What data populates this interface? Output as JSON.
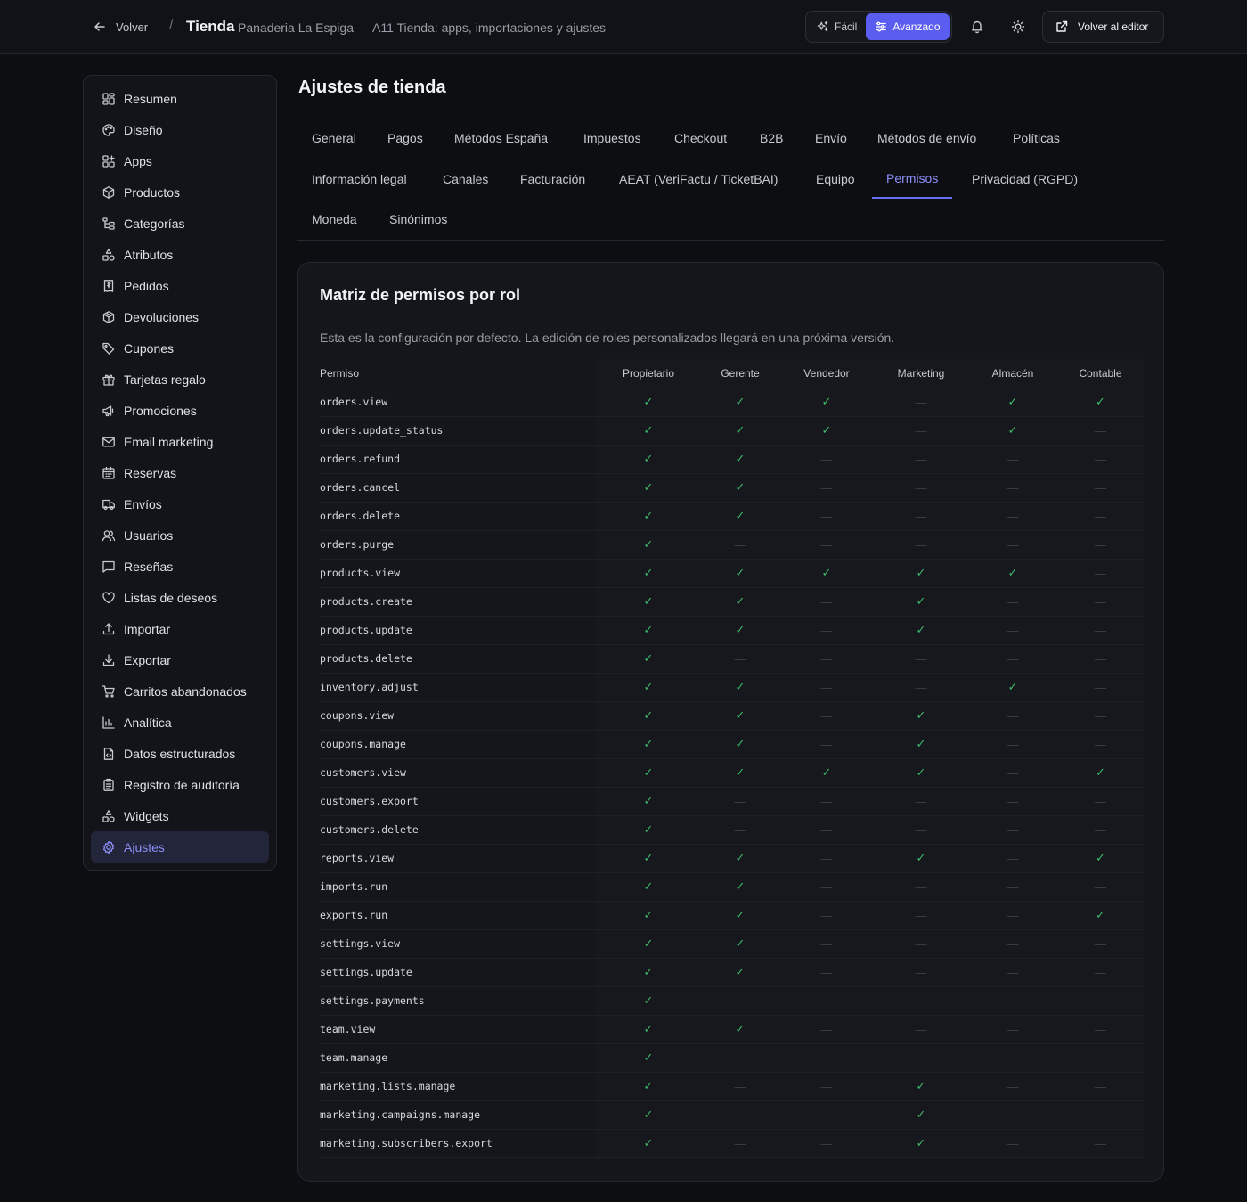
{
  "header": {
    "back_label": "Volver",
    "separator": "/",
    "title": "Tienda",
    "subtitle": "Panaderia La Espiga — A11 Tienda: apps, importaciones y ajustes",
    "mode_easy": "Fácil",
    "mode_advanced": "Avanzado",
    "active_mode": "Avanzado",
    "editor_button": "Volver al editor"
  },
  "colors": {
    "accent": "#5b5cf0",
    "active_link": "#8d8ff8",
    "check": "#3fb96a",
    "background": "#0d0e12"
  },
  "sidebar": {
    "active": "Ajustes",
    "items": [
      {
        "label": "Resumen",
        "icon": "dashboard-icon"
      },
      {
        "label": "Diseño",
        "icon": "palette-icon"
      },
      {
        "label": "Apps",
        "icon": "apps-icon"
      },
      {
        "label": "Productos",
        "icon": "box-icon"
      },
      {
        "label": "Categorías",
        "icon": "category-tree-icon"
      },
      {
        "label": "Atributos",
        "icon": "shapes-icon"
      },
      {
        "label": "Pedidos",
        "icon": "receipt-icon"
      },
      {
        "label": "Devoluciones",
        "icon": "package-return-icon"
      },
      {
        "label": "Cupones",
        "icon": "tag-icon"
      },
      {
        "label": "Tarjetas regalo",
        "icon": "gift-icon"
      },
      {
        "label": "Promociones",
        "icon": "megaphone-icon"
      },
      {
        "label": "Email marketing",
        "icon": "mail-icon"
      },
      {
        "label": "Reservas",
        "icon": "calendar-icon"
      },
      {
        "label": "Envíos",
        "icon": "truck-icon"
      },
      {
        "label": "Usuarios",
        "icon": "users-icon"
      },
      {
        "label": "Reseñas",
        "icon": "message-icon"
      },
      {
        "label": "Listas de deseos",
        "icon": "heart-icon"
      },
      {
        "label": "Importar",
        "icon": "upload-icon"
      },
      {
        "label": "Exportar",
        "icon": "download-icon"
      },
      {
        "label": "Carritos abandonados",
        "icon": "cart-icon"
      },
      {
        "label": "Analítica",
        "icon": "bar-chart-icon"
      },
      {
        "label": "Datos estructurados",
        "icon": "file-code-icon"
      },
      {
        "label": "Registro de auditoría",
        "icon": "clipboard-icon"
      },
      {
        "label": "Widgets",
        "icon": "widgets-icon"
      },
      {
        "label": "Ajustes",
        "icon": "gear-icon"
      }
    ]
  },
  "page": {
    "title": "Ajustes de tienda",
    "active_tab": "Permisos",
    "tab_rows": [
      [
        "General",
        "Pagos",
        "Métodos España",
        "Impuestos",
        "Checkout",
        "B2B",
        "Envío",
        "Métodos de envío",
        "Políticas"
      ],
      [
        "Información legal",
        "Canales",
        "Facturación",
        "AEAT (VeriFactu / TicketBAI)",
        "Equipo",
        "Permisos",
        "Privacidad (RGPD)"
      ],
      [
        "Moneda",
        "Sinónimos"
      ]
    ]
  },
  "matrix": {
    "title": "Matriz de permisos por rol",
    "description": "Esta es la configuración por defecto. La edición de roles personalizados llegará en una próxima versión.",
    "permission_header": "Permiso",
    "roles": [
      "Propietario",
      "Gerente",
      "Vendedor",
      "Marketing",
      "Almacén",
      "Contable"
    ],
    "yes_symbol": "✓",
    "no_symbol": "—",
    "rows": [
      {
        "perm": "orders.view",
        "values": [
          1,
          1,
          1,
          0,
          1,
          1
        ]
      },
      {
        "perm": "orders.update_status",
        "values": [
          1,
          1,
          1,
          0,
          1,
          0
        ]
      },
      {
        "perm": "orders.refund",
        "values": [
          1,
          1,
          0,
          0,
          0,
          0
        ]
      },
      {
        "perm": "orders.cancel",
        "values": [
          1,
          1,
          0,
          0,
          0,
          0
        ]
      },
      {
        "perm": "orders.delete",
        "values": [
          1,
          1,
          0,
          0,
          0,
          0
        ]
      },
      {
        "perm": "orders.purge",
        "values": [
          1,
          0,
          0,
          0,
          0,
          0
        ]
      },
      {
        "perm": "products.view",
        "values": [
          1,
          1,
          1,
          1,
          1,
          0
        ]
      },
      {
        "perm": "products.create",
        "values": [
          1,
          1,
          0,
          1,
          0,
          0
        ]
      },
      {
        "perm": "products.update",
        "values": [
          1,
          1,
          0,
          1,
          0,
          0
        ]
      },
      {
        "perm": "products.delete",
        "values": [
          1,
          0,
          0,
          0,
          0,
          0
        ]
      },
      {
        "perm": "inventory.adjust",
        "values": [
          1,
          1,
          0,
          0,
          1,
          0
        ]
      },
      {
        "perm": "coupons.view",
        "values": [
          1,
          1,
          0,
          1,
          0,
          0
        ]
      },
      {
        "perm": "coupons.manage",
        "values": [
          1,
          1,
          0,
          1,
          0,
          0
        ]
      },
      {
        "perm": "customers.view",
        "values": [
          1,
          1,
          1,
          1,
          0,
          1
        ]
      },
      {
        "perm": "customers.export",
        "values": [
          1,
          0,
          0,
          0,
          0,
          0
        ]
      },
      {
        "perm": "customers.delete",
        "values": [
          1,
          0,
          0,
          0,
          0,
          0
        ]
      },
      {
        "perm": "reports.view",
        "values": [
          1,
          1,
          0,
          1,
          0,
          1
        ]
      },
      {
        "perm": "imports.run",
        "values": [
          1,
          1,
          0,
          0,
          0,
          0
        ]
      },
      {
        "perm": "exports.run",
        "values": [
          1,
          1,
          0,
          0,
          0,
          1
        ]
      },
      {
        "perm": "settings.view",
        "values": [
          1,
          1,
          0,
          0,
          0,
          0
        ]
      },
      {
        "perm": "settings.update",
        "values": [
          1,
          1,
          0,
          0,
          0,
          0
        ]
      },
      {
        "perm": "settings.payments",
        "values": [
          1,
          0,
          0,
          0,
          0,
          0
        ]
      },
      {
        "perm": "team.view",
        "values": [
          1,
          1,
          0,
          0,
          0,
          0
        ]
      },
      {
        "perm": "team.manage",
        "values": [
          1,
          0,
          0,
          0,
          0,
          0
        ]
      },
      {
        "perm": "marketing.lists.manage",
        "values": [
          1,
          0,
          0,
          1,
          0,
          0
        ]
      },
      {
        "perm": "marketing.campaigns.manage",
        "values": [
          1,
          0,
          0,
          1,
          0,
          0
        ]
      },
      {
        "perm": "marketing.subscribers.export",
        "values": [
          1,
          0,
          0,
          1,
          0,
          0
        ]
      }
    ]
  }
}
